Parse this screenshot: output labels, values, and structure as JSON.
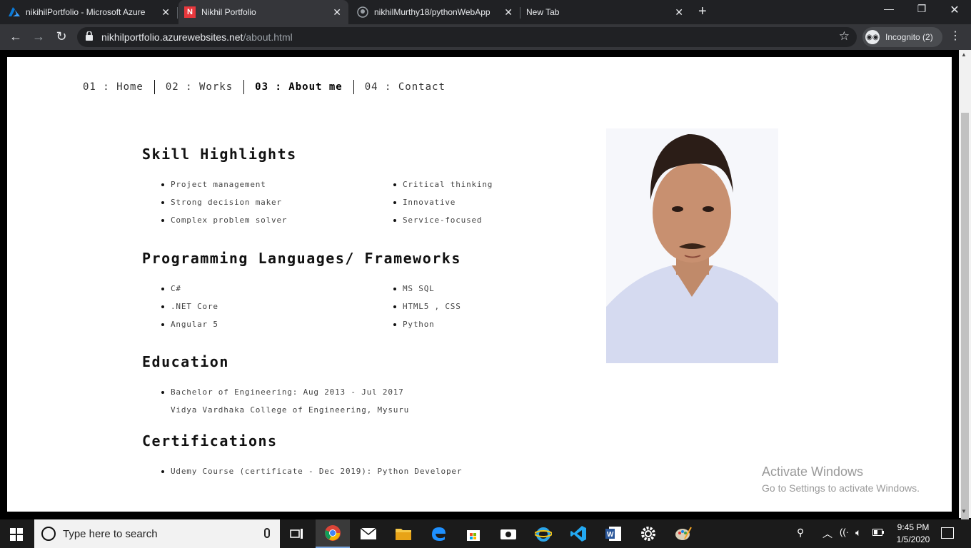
{
  "browser": {
    "tabs": [
      {
        "title": "nikihilPortfolio - Microsoft Azure",
        "icon": "azure-icon",
        "active": false
      },
      {
        "title": "Nikhil Portfolio",
        "icon": "portfolio-n-icon",
        "active": true
      },
      {
        "title": "nikhilMurthy18/pythonWebApp",
        "icon": "github-icon",
        "active": false
      },
      {
        "title": "New Tab",
        "icon": "",
        "active": false
      }
    ],
    "url_host": "nikhilportfolio.azurewebsites.net",
    "url_path": "/about.html",
    "incognito_label": "Incognito (2)",
    "colors": {
      "frame": "#202124",
      "toolbar": "#35363a",
      "active_tab_icon": "#e8383d",
      "azure": "#0a7ad8"
    }
  },
  "page": {
    "nav": [
      {
        "label": "01 : Home",
        "active": false
      },
      {
        "label": "02 : Works",
        "active": false
      },
      {
        "label": "03 : About me",
        "active": true
      },
      {
        "label": "04 : Contact",
        "active": false
      }
    ],
    "skills": {
      "heading": "Skill Highlights",
      "left": [
        "Project management",
        "Strong decision maker",
        "Complex problem solver"
      ],
      "right": [
        "Critical thinking",
        "Innovative",
        "Service-focused"
      ]
    },
    "languages": {
      "heading": "Programming Languages/ Frameworks",
      "left": [
        "C#",
        ".NET Core",
        "Angular 5"
      ],
      "right": [
        "MS SQL",
        "HTML5 , CSS",
        "Python"
      ]
    },
    "education": {
      "heading": "Education",
      "line1": "Bachelor of Engineering: Aug 2013 - Jul 2017",
      "line2": "Vidya Vardhaka College of Engineering, Mysuru"
    },
    "certifications": {
      "heading": "Certifications",
      "item": "Udemy Course (certificate - Dec 2019): Python Developer"
    },
    "watermark": {
      "line1": "Activate Windows",
      "line2": "Go to Settings to activate Windows."
    }
  },
  "taskbar": {
    "search_placeholder": "Type here to search",
    "time": "9:45 PM",
    "date": "1/5/2020",
    "apps": [
      "task-view-icon",
      "chrome-icon",
      "mail-icon",
      "file-explorer-icon",
      "edge-icon",
      "store-icon",
      "camera-icon",
      "internet-explorer-icon",
      "vscode-icon",
      "word-icon",
      "settings-icon",
      "paint-icon"
    ]
  }
}
